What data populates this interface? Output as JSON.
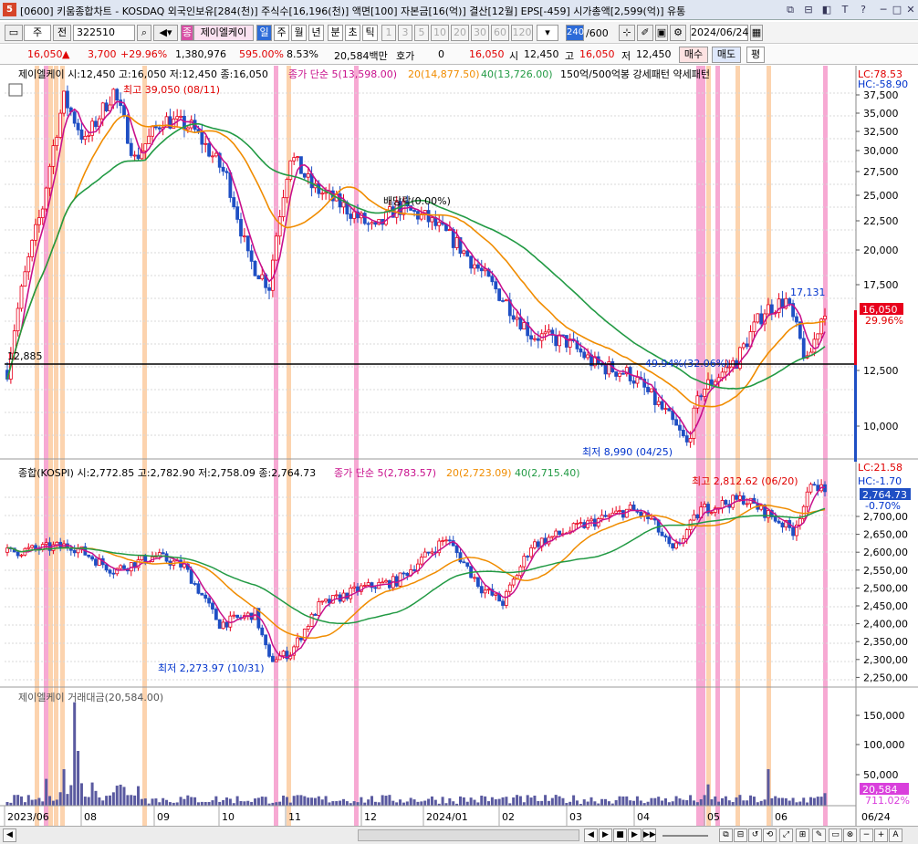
{
  "title_bar": {
    "badge": "5",
    "text": "[0600] 키움종합차트 - KOSDAQ 외국인보유[284(천)] 주식수[16,196(천)] 액면[100] 자본금[16(억)] 결산[12월] EPS[-459] 시가총액[2,599(억)] 유통",
    "buttons": [
      "⧉",
      "⊟",
      "◧",
      "T",
      "?",
      "─",
      "□",
      "✕"
    ]
  },
  "toolbar": {
    "market": "주",
    "prev": "전",
    "code": "322510",
    "name": "제이엘케이",
    "name_badge": "종",
    "periods": [
      "일",
      "주",
      "월",
      "년",
      "분",
      "초",
      "틱"
    ],
    "numbers": [
      "1",
      "3",
      "5",
      "10",
      "20",
      "30",
      "60",
      "120"
    ],
    "count_current": "240",
    "count_total": "/600",
    "date": "2024/06/24"
  },
  "quote": {
    "price": "16,050",
    "change": "3,700",
    "rate": "+29.96%",
    "volume": "1,380,976",
    "vol_rate": "595.00%",
    "turnover": "8.53%",
    "amount": "20,584백만",
    "hoga_label": "호가",
    "hoga": "0",
    "hoga_price": "16,050",
    "open_label": "시",
    "open": "12,450",
    "high_label": "고",
    "high": "16,050",
    "low_label": "저",
    "low": "12,450",
    "buy": "매수",
    "sell": "매도",
    "avg": "평"
  },
  "main_panel": {
    "legend_price": "제이엘케이 시:12,450 고:16,050 저:12,450 종:16,050",
    "legend_ma": "종가 단순 5(13,598.00)",
    "legend_ma20": "20(14,877.50)",
    "legend_ma40": "40(13,726.00)",
    "legend_pattern": "150억/500억봉 강세패턴 약세패턴",
    "lc": "LC:78.53",
    "hc": "HC:-58.90",
    "max_label": "최고 39,050 (08/11)",
    "min_label": "최저 8,990 (04/25)",
    "dividend": "배당락(0.00%)",
    "peak_label": "17,131",
    "fib_label": "49.94%(32.06%)",
    "hline_label": "12,885",
    "cur_price": "16,050",
    "cur_rate": "29.96%",
    "ticks": [
      "37,500",
      "35,000",
      "32,500",
      "30,000",
      "27,500",
      "25,000",
      "22,500",
      "20,000",
      "17,500",
      "12,500",
      "10,000"
    ]
  },
  "kospi_panel": {
    "legend": "종합(KOSPI) 시:2,772.85 고:2,782.90 저:2,758.09 종:2,764.73",
    "legend_ma": "종가 단순 5(2,783.57)",
    "legend_ma20": "20(2,723.09)",
    "legend_ma40": "40(2,715.40)",
    "lc": "LC:21.58",
    "hc": "HC:-1.70",
    "max_label": "최고 2,812.62 (06/20)",
    "min_label": "최저 2,273.97 (10/31)",
    "cur_price": "2,764.73",
    "cur_rate": "-0.70%",
    "ticks": [
      "2,700,00",
      "2,650,00",
      "2,600,00",
      "2,550,00",
      "2,500,00",
      "2,450,00",
      "2,400,00",
      "2,350,00",
      "2,300,00",
      "2,250,00"
    ]
  },
  "amount_panel": {
    "legend": "제이엘케이 거래대금(20,584.00)",
    "cur_value": "20,584",
    "cur_rate": "711.02%",
    "ticks": [
      "150,000",
      "100,000",
      "50,000"
    ]
  },
  "x_axis": {
    "labels": [
      "2023/06",
      "08",
      "09",
      "10",
      "11",
      "12",
      "2024/01",
      "02",
      "03",
      "04",
      "05",
      "06"
    ],
    "end_label": "06/24"
  },
  "colors": {
    "up": "#e8001c",
    "down": "#1f4fc4",
    "ma5": "#c8108c",
    "ma20": "#f08c00",
    "ma40": "#229a44",
    "band_orange": "#fbc89a",
    "band_pink": "#f593c8"
  }
}
